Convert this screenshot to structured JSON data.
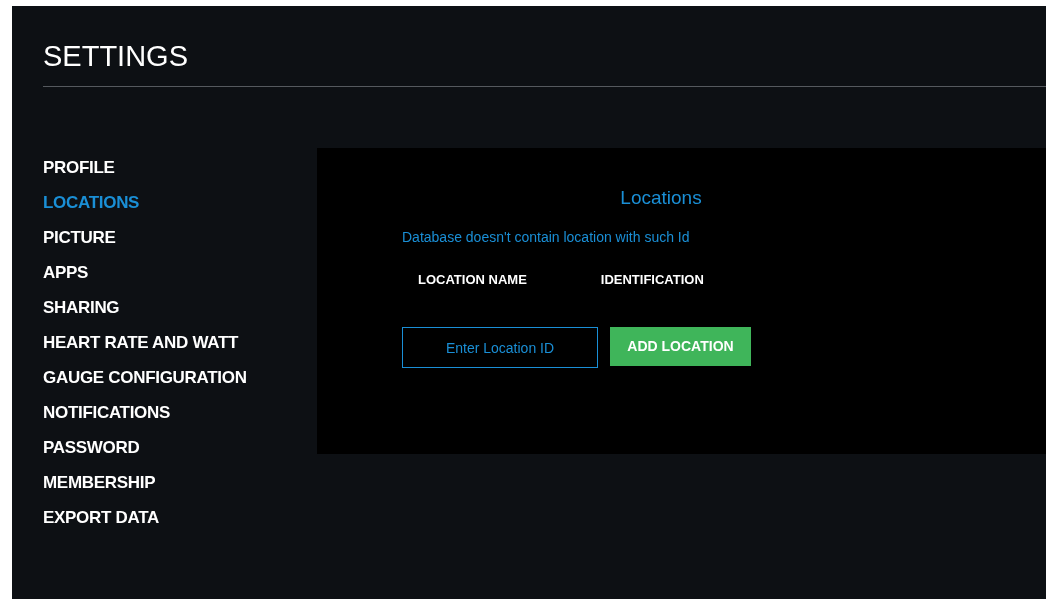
{
  "title": "SETTINGS",
  "sidebar": {
    "items": [
      {
        "label": "PROFILE",
        "selected": false
      },
      {
        "label": "LOCATIONS",
        "selected": true
      },
      {
        "label": "PICTURE",
        "selected": false
      },
      {
        "label": "APPS",
        "selected": false
      },
      {
        "label": "SHARING",
        "selected": false
      },
      {
        "label": "HEART RATE AND WATT",
        "selected": false
      },
      {
        "label": "GAUGE CONFIGURATION",
        "selected": false
      },
      {
        "label": "NOTIFICATIONS",
        "selected": false
      },
      {
        "label": "PASSWORD",
        "selected": false
      },
      {
        "label": "MEMBERSHIP",
        "selected": false
      },
      {
        "label": "EXPORT DATA",
        "selected": false
      }
    ]
  },
  "panel": {
    "heading": "Locations",
    "error": "Database doesn't contain location with such Id",
    "columns": [
      "LOCATION NAME",
      "IDENTIFICATION"
    ],
    "input": {
      "placeholder": "Enter Location ID"
    },
    "button": "ADD LOCATION"
  }
}
